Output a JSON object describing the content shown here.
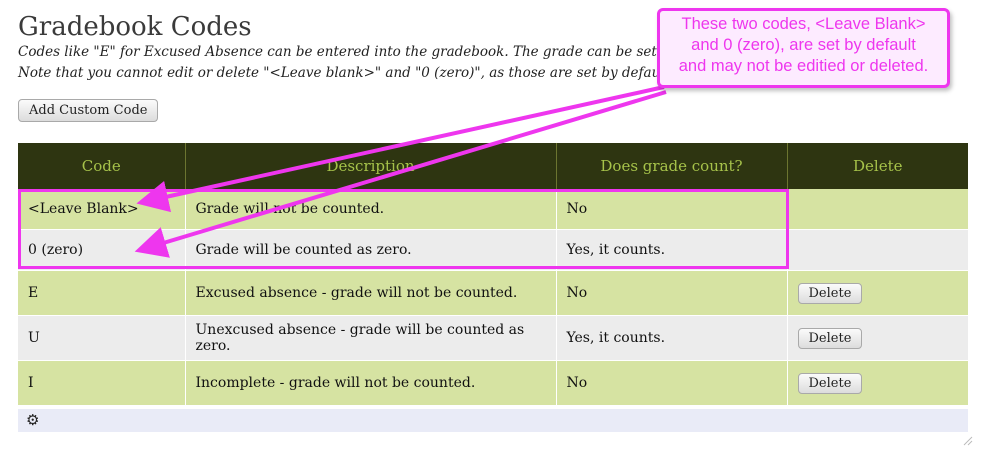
{
  "page": {
    "title": "Gradebook Codes",
    "description_line1": "Codes like \"E\" for Excused Absence can be entered into the gradebook. The grade can be set to",
    "description_line2": "Note that you cannot edit or delete \"<Leave blank>\" and \"0 (zero)\", as those are set by default."
  },
  "toolbar": {
    "add_custom_code_label": "Add Custom Code"
  },
  "table": {
    "headers": [
      "Code",
      "Description",
      "Does grade count?",
      "Delete"
    ],
    "rows": [
      {
        "code": "<Leave Blank>",
        "description": "Grade will not be counted.",
        "counts": "No",
        "delete_label": ""
      },
      {
        "code": "0 (zero)",
        "description": "Grade will be counted as zero.",
        "counts": "Yes, it counts.",
        "delete_label": ""
      },
      {
        "code": "E",
        "description": "Excused absence - grade will not be counted.",
        "counts": "No",
        "delete_label": "Delete"
      },
      {
        "code": "U",
        "description": "Unexcused absence - grade will be counted as zero.",
        "counts": "Yes, it counts.",
        "delete_label": "Delete"
      },
      {
        "code": "I",
        "description": "Incomplete - grade will not be counted.",
        "counts": "No",
        "delete_label": "Delete"
      }
    ]
  },
  "footer": {
    "settings_icon": "gear-icon"
  },
  "annotation": {
    "line1": "These two codes, <Leave Blank>",
    "line2": "and 0 (zero), are set by default",
    "line3": "and may not be editied or deleted.",
    "color": "#ee36ee"
  },
  "colors": {
    "header_bg": "#2e3511",
    "header_text": "#a6c24a",
    "row_green": "#d6e3a2",
    "row_gray": "#ececec"
  }
}
